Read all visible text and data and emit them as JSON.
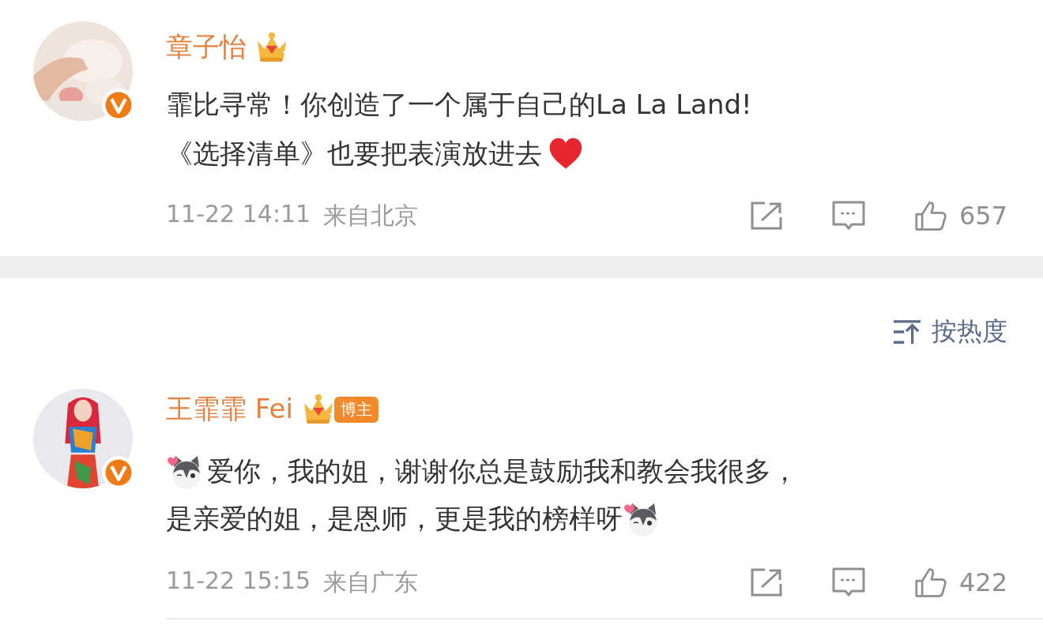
{
  "pinned_comment": {
    "author": "章子怡",
    "verified": true,
    "lines": [
      [
        {
          "kind": "text",
          "text": "霏比寻常！你创造了一个属于自己的La La Land!"
        }
      ],
      [
        {
          "kind": "text",
          "text": "《选择清单》也要把表演放进去"
        },
        {
          "kind": "heart"
        }
      ]
    ],
    "time": "11-22 14:11",
    "location": "来自北京",
    "likes": "657"
  },
  "comment_list": {
    "sort": "按热度",
    "comments": [
      {
        "author": "王霏霏 Fei",
        "verified": true,
        "tag": "博主",
        "lines": [
          [
            {
              "kind": "cat"
            },
            {
              "kind": "text",
              "text": "爱你，我的姐，谢谢你总是鼓励我和教会我很多，"
            }
          ],
          [
            {
              "kind": "text",
              "text": "是亲爱的姐，是恩师，更是我的榜样呀"
            },
            {
              "kind": "cat"
            }
          ]
        ],
        "time": "11-22 15:15",
        "location": "来自广东",
        "likes": "422"
      }
    ]
  }
}
